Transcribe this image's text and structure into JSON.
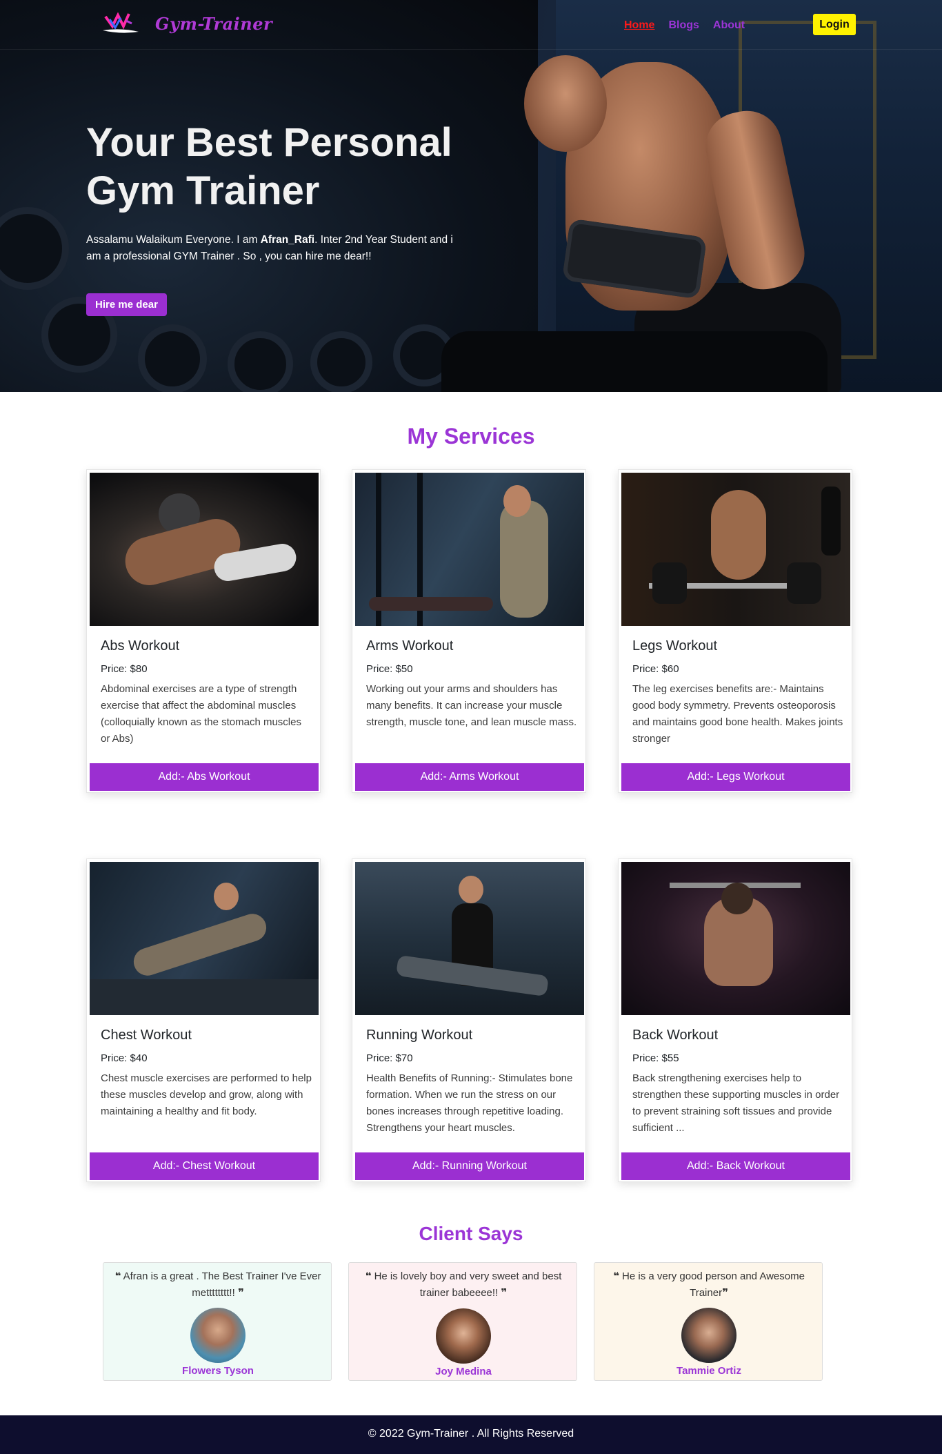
{
  "nav": {
    "brand": "Gym-Trainer",
    "links": [
      "Home",
      "Blogs",
      "About"
    ],
    "login_label": "Login"
  },
  "hero": {
    "title": "Your Best Personal Gym Trainer",
    "desc_prefix": "Assalamu Walaikum Everyone. I am ",
    "desc_name": "Afran_Rafi",
    "desc_suffix": ". Inter 2nd Year Student and i am a professional GYM Trainer . So , you can hire me dear!!",
    "cta_label": "Hire me dear"
  },
  "services": {
    "title": "My Services",
    "items": [
      {
        "name": "Abs Workout",
        "price": "Price: $80",
        "desc": "Abdominal exercises are a type of strength exercise that affect the abdominal muscles (colloquially known as the stomach muscles or Abs)",
        "button": "Add:- Abs Workout"
      },
      {
        "name": "Arms Workout",
        "price": "Price: $50",
        "desc": "Working out your arms and shoulders has many benefits. It can increase your muscle strength, muscle tone, and lean muscle mass.",
        "button": "Add:- Arms Workout"
      },
      {
        "name": "Legs Workout",
        "price": "Price: $60",
        "desc": "The leg exercises benefits are:- Maintains good body symmetry. Prevents osteoporosis and maintains good bone health. Makes joints stronger",
        "button": "Add:- Legs Workout"
      },
      {
        "name": "Chest Workout",
        "price": "Price: $40",
        "desc": "Chest muscle exercises are performed to help these muscles develop and grow, along with maintaining a healthy and fit body.",
        "button": "Add:- Chest Workout"
      },
      {
        "name": "Running Workout",
        "price": "Price: $70",
        "desc": "Health Benefits of Running:- Stimulates bone formation. When we run the stress on our bones increases through repetitive loading. Strengthens your heart muscles.",
        "button": "Add:- Running Workout"
      },
      {
        "name": "Back Workout",
        "price": "Price: $55",
        "desc": "Back strengthening exercises help to strengthen these supporting muscles in order to prevent straining soft tissues and provide sufficient ...",
        "button": "Add:- Back Workout"
      }
    ]
  },
  "clients": {
    "title": "Client Says",
    "items": [
      {
        "quote": "Afran is a great . The Best Trainer I've Ever metttttttt!!",
        "name": "Flowers Tyson",
        "bg": "#effaf6"
      },
      {
        "quote": "He is lovely boy and very sweet and best trainer babeeee!!",
        "name": "Joy Medina",
        "bg": "#fdf0f2"
      },
      {
        "quote": "He is a very good person and Awesome Trainer",
        "name": "Tammie Ortiz",
        "bg": "#fdf6ea"
      }
    ]
  },
  "footer": {
    "copyright": "© 2022 Gym-Trainer . All Rights Reserved"
  },
  "colors": {
    "accent": "#9b2fd1",
    "active_link": "#ff1a1a",
    "login_bg": "#fff200",
    "footer_bg": "#0e0e2e"
  },
  "icons": [
    "quote-open-icon",
    "quote-close-icon",
    "logo-icon"
  ]
}
